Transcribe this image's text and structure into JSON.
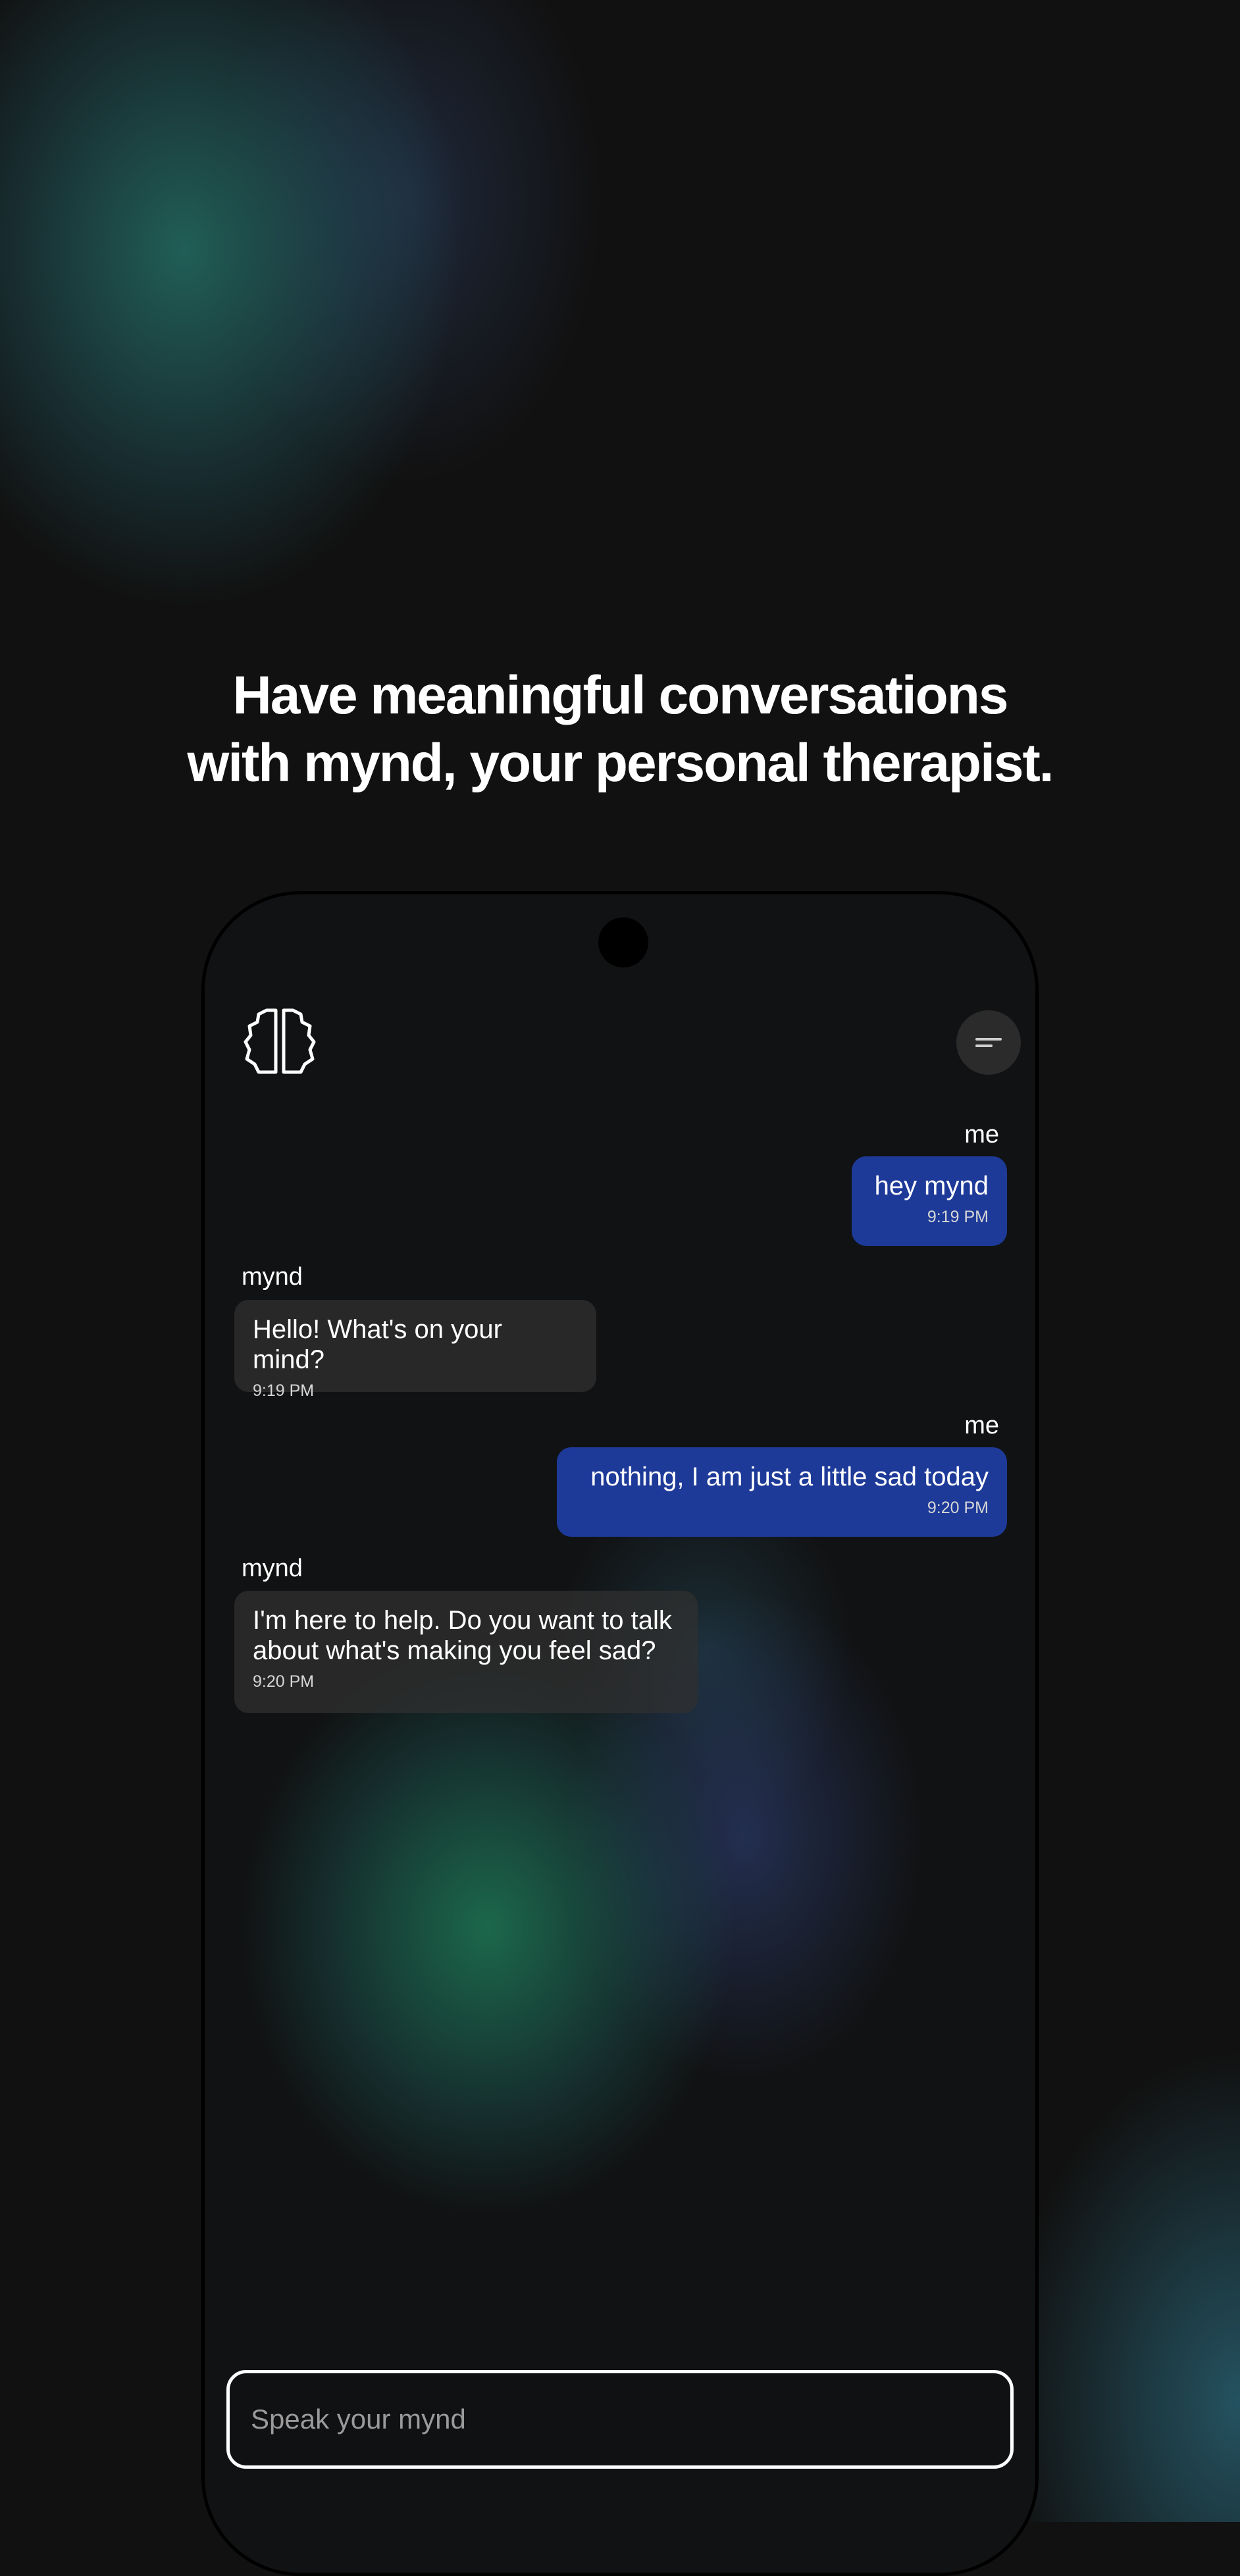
{
  "headline": {
    "line1": "Have meaningful conversations",
    "line2": "with mynd, your personal therapist."
  },
  "app": {
    "logo_icon": "brain-icon",
    "menu_icon": "menu-icon"
  },
  "messages": [
    {
      "sender": "me",
      "text": "hey mynd",
      "time": "9:19 PM"
    },
    {
      "sender": "mynd",
      "text": "Hello! What's on your mind?",
      "time": "9:19 PM"
    },
    {
      "sender": "me",
      "text": "nothing, I am just a little sad today",
      "time": "9:20 PM"
    },
    {
      "sender": "mynd",
      "text": "I'm here to help. Do you want to talk about what's making you feel sad?",
      "time": "9:20 PM"
    }
  ],
  "input": {
    "placeholder": "Speak your mynd",
    "value": ""
  },
  "colors": {
    "user_bubble": "#1e3a99",
    "bot_bubble": "#303030",
    "background": "#111111"
  }
}
